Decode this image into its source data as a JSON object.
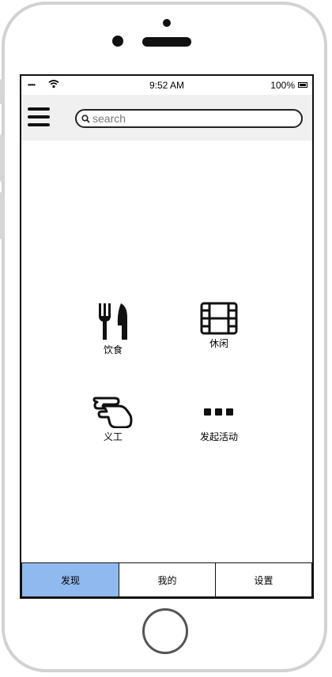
{
  "status_bar": {
    "signal": "•••••",
    "time": "9:52 AM",
    "battery": "100%"
  },
  "search": {
    "placeholder": "search"
  },
  "categories": [
    {
      "label": "饮食",
      "icon": "fork-knife-icon"
    },
    {
      "label": "休闲",
      "icon": "film-icon"
    },
    {
      "label": "义工",
      "icon": "hand-icon"
    },
    {
      "label": "发起活动",
      "icon": "more-icon"
    }
  ],
  "tabs": [
    {
      "label": "发现",
      "active": true
    },
    {
      "label": "我的",
      "active": false
    },
    {
      "label": "设置",
      "active": false
    }
  ],
  "colors": {
    "active_tab": "#8fb9ef",
    "topbar": "#f0f0f0",
    "phone_frame": "#d2d2d2"
  }
}
